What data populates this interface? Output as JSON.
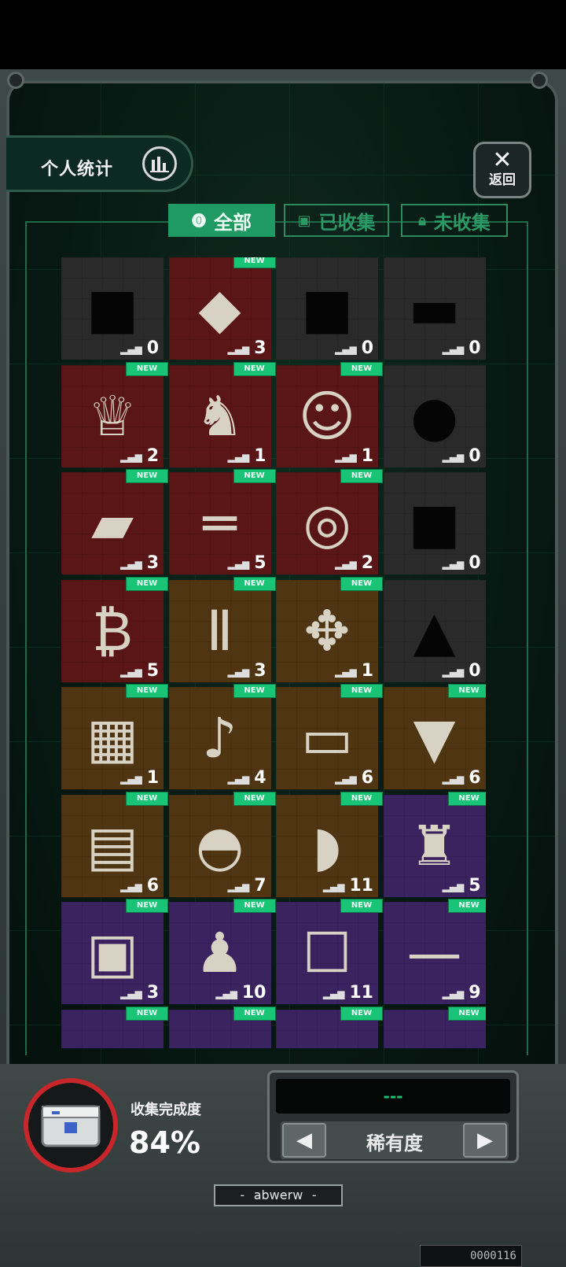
{
  "header": {
    "stats_label": "个人统计",
    "back_label": "返回"
  },
  "tabs": [
    {
      "label": "全部",
      "active": true
    },
    {
      "label": "已收集",
      "active": false
    },
    {
      "label": "未收集",
      "active": false
    }
  ],
  "badge_text": "NEW",
  "items": [
    {
      "count": "0",
      "rarity": "gray",
      "new": false,
      "icon": "silhouette-box-icon"
    },
    {
      "count": "3",
      "rarity": "red",
      "new": true,
      "icon": "crystal-icon"
    },
    {
      "count": "0",
      "rarity": "gray",
      "new": false,
      "icon": "silhouette-crate-icon"
    },
    {
      "count": "0",
      "rarity": "gray",
      "new": false,
      "icon": "silhouette-car-icon"
    },
    {
      "count": "2",
      "rarity": "red",
      "new": true,
      "icon": "trophy-icon"
    },
    {
      "count": "1",
      "rarity": "red",
      "new": true,
      "icon": "statue-icon"
    },
    {
      "count": "1",
      "rarity": "red",
      "new": true,
      "icon": "cat-plush-icon"
    },
    {
      "count": "0",
      "rarity": "gray",
      "new": false,
      "icon": "silhouette-animal-icon"
    },
    {
      "count": "3",
      "rarity": "red",
      "new": true,
      "icon": "card-icon"
    },
    {
      "count": "5",
      "rarity": "red",
      "new": true,
      "icon": "wooden-sticks-icon"
    },
    {
      "count": "2",
      "rarity": "red",
      "new": true,
      "icon": "silver-coin-icon"
    },
    {
      "count": "0",
      "rarity": "gray",
      "new": false,
      "icon": "silhouette-box-icon"
    },
    {
      "count": "5",
      "rarity": "red",
      "new": true,
      "icon": "bitcoin-icon"
    },
    {
      "count": "3",
      "rarity": "gold",
      "new": true,
      "icon": "overalls-icon"
    },
    {
      "count": "1",
      "rarity": "gold",
      "new": true,
      "icon": "drone-icon"
    },
    {
      "count": "0",
      "rarity": "gray",
      "new": false,
      "icon": "silhouette-robot-dog-icon"
    },
    {
      "count": "1",
      "rarity": "gold",
      "new": true,
      "icon": "map-icon"
    },
    {
      "count": "4",
      "rarity": "gold",
      "new": true,
      "icon": "guitar-icon"
    },
    {
      "count": "6",
      "rarity": "gold",
      "new": true,
      "icon": "bar-icon"
    },
    {
      "count": "6",
      "rarity": "gold",
      "new": true,
      "icon": "spinning-top-icon"
    },
    {
      "count": "6",
      "rarity": "gold",
      "new": true,
      "icon": "graphics-card-icon"
    },
    {
      "count": "7",
      "rarity": "gold",
      "new": true,
      "icon": "helmet-icon"
    },
    {
      "count": "11",
      "rarity": "gold",
      "new": true,
      "icon": "cheese-icon"
    },
    {
      "count": "5",
      "rarity": "purple",
      "new": true,
      "icon": "terracotta-warrior-icon"
    },
    {
      "count": "3",
      "rarity": "purple",
      "new": true,
      "icon": "device-icon"
    },
    {
      "count": "10",
      "rarity": "purple",
      "new": true,
      "icon": "pallbearers-icon"
    },
    {
      "count": "11",
      "rarity": "purple",
      "new": true,
      "icon": "bmo-icon"
    },
    {
      "count": "9",
      "rarity": "purple",
      "new": true,
      "icon": "staff-icon"
    },
    {
      "count": "",
      "rarity": "purple",
      "new": true,
      "icon": "partial-item-icon"
    },
    {
      "count": "",
      "rarity": "purple",
      "new": true,
      "icon": "partial-item-icon"
    },
    {
      "count": "",
      "rarity": "purple",
      "new": true,
      "icon": "partial-item-icon"
    },
    {
      "count": "",
      "rarity": "purple",
      "new": true,
      "icon": "partial-item-icon"
    }
  ],
  "progress": {
    "label": "收集完成度",
    "value": "84%",
    "fraction": 0.84
  },
  "rarity": {
    "screen_text": "---",
    "label": "稀有度"
  },
  "nameplate": "- 𝖺𝖻𝗐𝖾𝗋𝗐 -",
  "serial": "0000116",
  "colors": {
    "accent": "#19c476",
    "gray": "#2a2a2a",
    "red": "#5a1517",
    "gold": "#4f3512",
    "purple": "#3b2360"
  }
}
